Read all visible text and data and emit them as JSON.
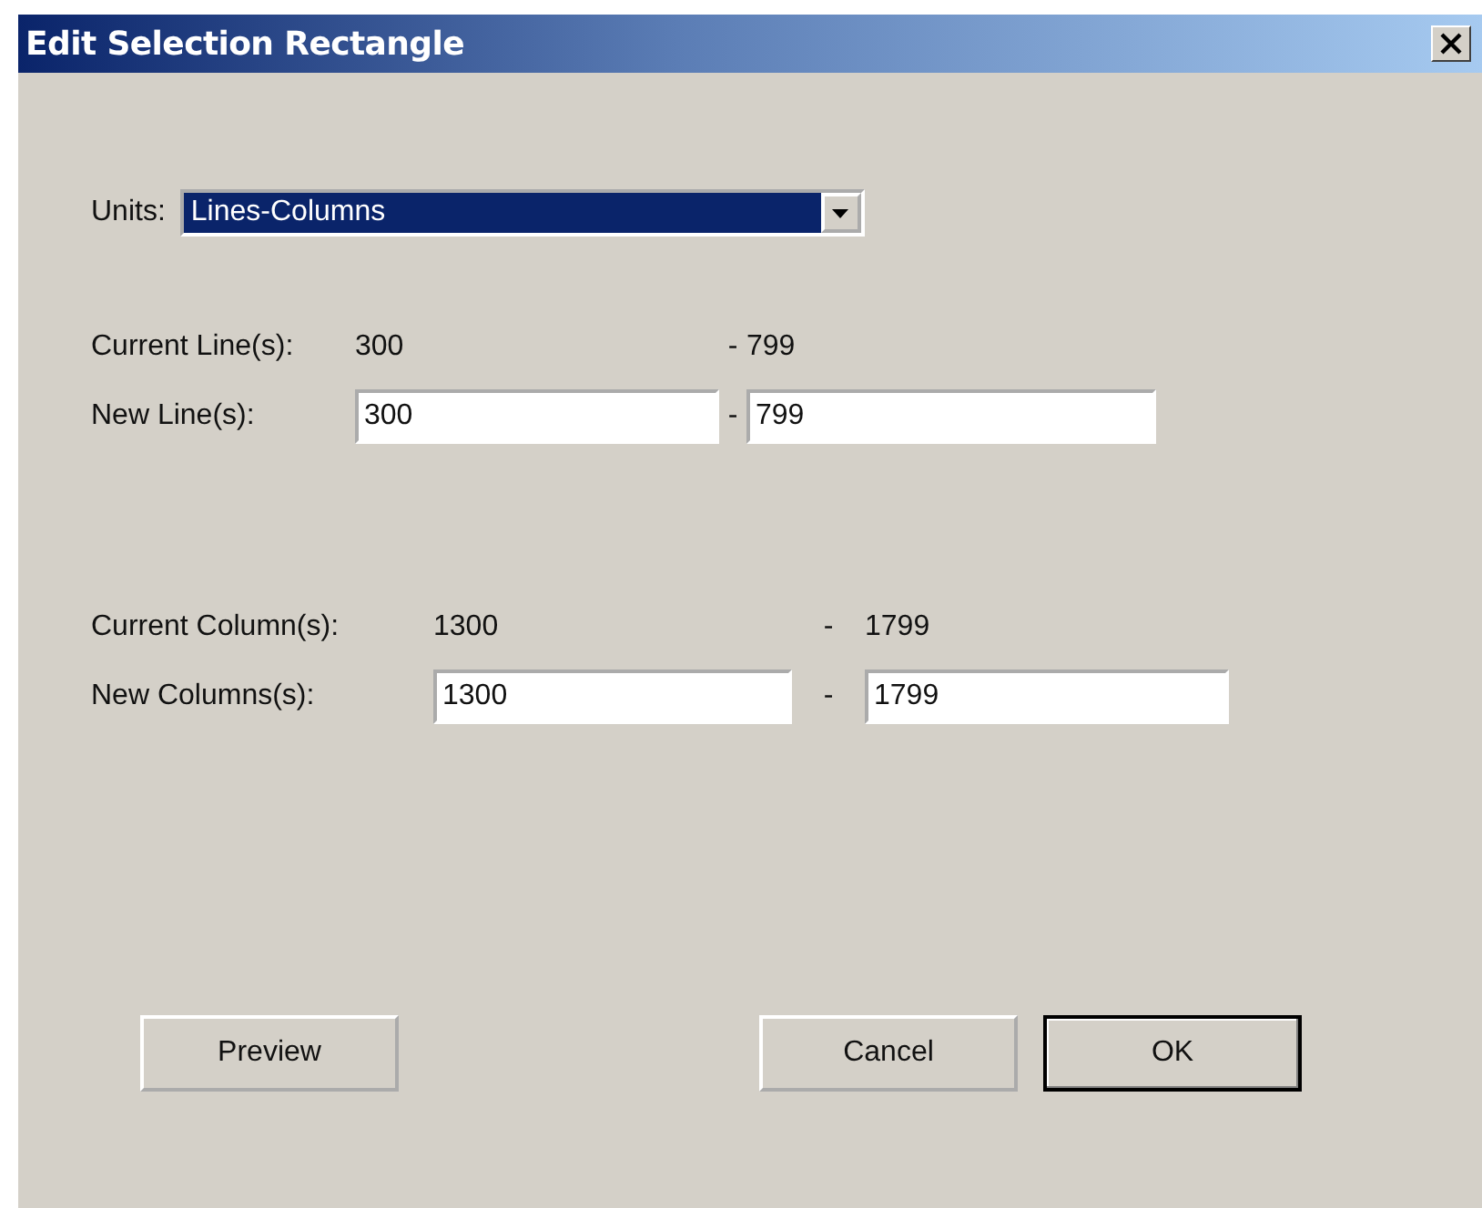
{
  "window": {
    "title": "Edit Selection Rectangle"
  },
  "units": {
    "label": "Units:",
    "value": "Lines-Columns"
  },
  "ranges": [
    {
      "current_label": "Current Line(s):",
      "current_from": "300",
      "current_separator": "-",
      "current_to": "799",
      "new_label": "New Line(s):",
      "new_from": "300",
      "new_separator": "-",
      "new_to": "799"
    },
    {
      "current_label": "Current Column(s):",
      "current_from": "1300",
      "current_separator": "-",
      "current_to": "1799",
      "new_label": "New Columns(s):",
      "new_from": "1300",
      "new_separator": "-",
      "new_to": "1799"
    }
  ],
  "buttons": [
    {
      "label": "Preview",
      "default": false
    },
    {
      "label": "Cancel",
      "default": false
    },
    {
      "label": "OK",
      "default": true
    }
  ]
}
